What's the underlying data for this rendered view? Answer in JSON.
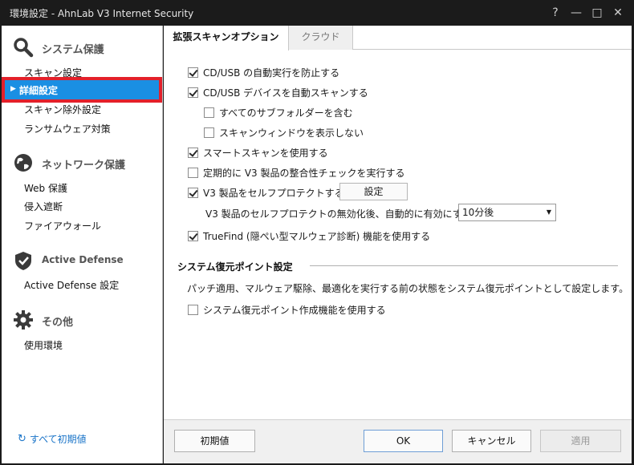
{
  "window": {
    "title": "環境設定 - AhnLab V3 Internet Security",
    "help": "?",
    "minimize": "—",
    "maximize": "□",
    "close": "✕"
  },
  "sidebar": {
    "sections": [
      {
        "title": "システム保護",
        "icon": "magnifier-icon",
        "items": [
          "スキャン設定",
          "詳細設定",
          "スキャン除外設定",
          "ランサムウェア対策"
        ]
      },
      {
        "title": "ネットワーク保護",
        "icon": "globe-icon",
        "items": [
          "Web 保護",
          "侵入遮断",
          "ファイアウォール"
        ]
      },
      {
        "title": "Active Defense",
        "icon": "shield-icon",
        "items": [
          "Active Defense 設定"
        ]
      },
      {
        "title": "その他",
        "icon": "gear-icon",
        "items": [
          "使用環境"
        ]
      }
    ],
    "selected": "詳細設定",
    "reset_all": "すべて初期値",
    "highlight_color": "#e3202a",
    "selected_color": "#1a8fe3"
  },
  "tabs": [
    {
      "label": "拡張スキャンオプション",
      "active": true
    },
    {
      "label": "クラウド",
      "active": false
    }
  ],
  "options": [
    {
      "label": "CD/USB の自動実行を防止する",
      "checked": true
    },
    {
      "label": "CD/USB デバイスを自動スキャンする",
      "checked": true
    },
    {
      "label": "すべてのサブフォルダーを含む",
      "checked": false
    },
    {
      "label": "スキャンウィンドウを表示しない",
      "checked": false
    },
    {
      "label": "スマートスキャンを使用する",
      "checked": true
    },
    {
      "label": "定期的に V3 製品の整合性チェックを実行する",
      "checked": false
    },
    {
      "label": "V3 製品をセルフプロテクトする",
      "checked": true
    },
    {
      "label": "TrueFind (隠ぺい型マルウェア診断) 機能を使用する",
      "checked": true
    }
  ],
  "self_protect": {
    "settings_button": "設定",
    "reenable_label": "V3 製品のセルフプロテクトの無効化後、自動的に有効にする",
    "reenable_value": "10分後"
  },
  "restore": {
    "heading": "システム復元ポイント設定",
    "description": "パッチ適用、マルウェア駆除、最適化を実行する前の状態をシステム復元ポイントとして設定します。",
    "option": {
      "label": "システム復元ポイント作成機能を使用する",
      "checked": false
    }
  },
  "buttons": {
    "default": "初期値",
    "ok": "OK",
    "cancel": "キャンセル",
    "apply": "適用"
  }
}
